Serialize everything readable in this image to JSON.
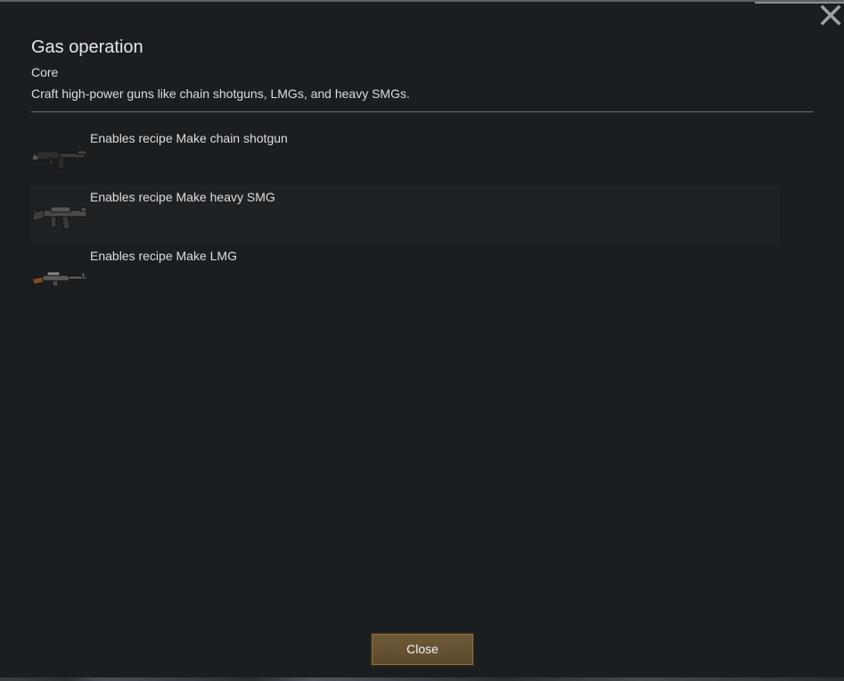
{
  "dialog": {
    "title": "Gas operation",
    "subtitle": "Core",
    "description": "Craft high-power guns like chain shotguns, LMGs, and heavy SMGs."
  },
  "recipes": [
    {
      "label": "Enables recipe Make chain shotgun",
      "icon": "chain-shotgun-icon"
    },
    {
      "label": "Enables recipe Make heavy SMG",
      "icon": "heavy-smg-icon"
    },
    {
      "label": "Enables recipe Make LMG",
      "icon": "lmg-icon"
    }
  ],
  "buttons": {
    "close_label": "Close",
    "close_icon": "close-icon"
  },
  "colors": {
    "background": "#1b1e21",
    "button": "#6e5a38",
    "text": "#dedede"
  }
}
